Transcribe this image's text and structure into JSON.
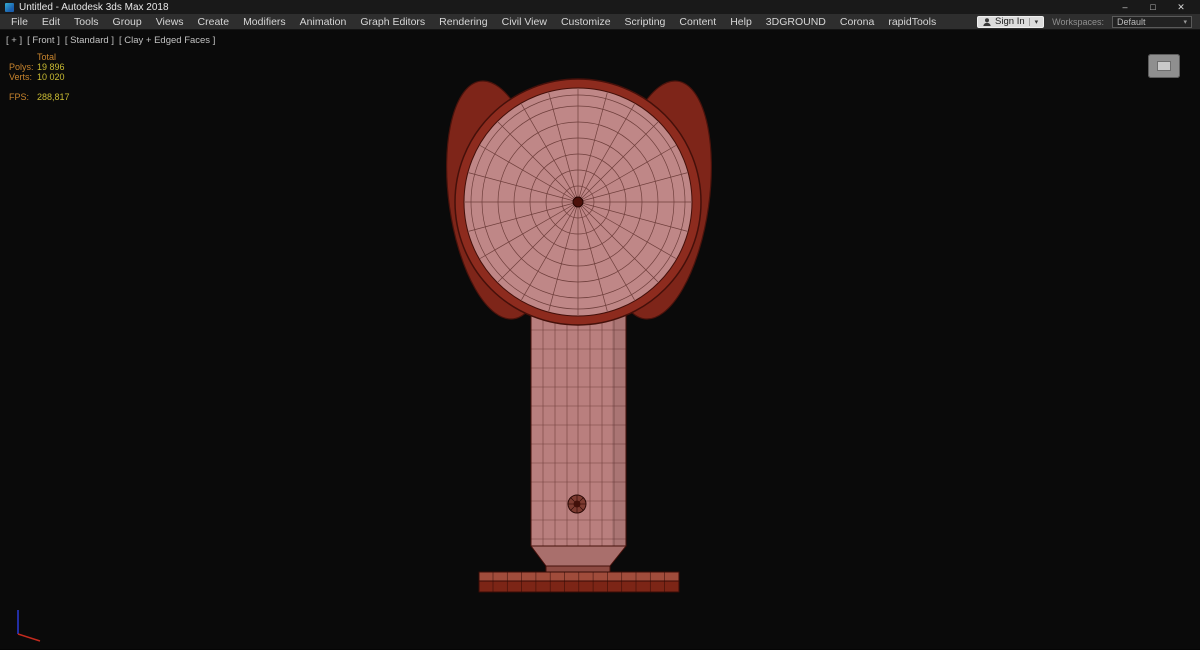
{
  "window": {
    "title": "Untitled - Autodesk 3ds Max 2018",
    "controls": {
      "minimize": "–",
      "maximize": "□",
      "close": "✕"
    }
  },
  "menubar": {
    "items": [
      "File",
      "Edit",
      "Tools",
      "Group",
      "Views",
      "Create",
      "Modifiers",
      "Animation",
      "Graph Editors",
      "Rendering",
      "Civil View",
      "Customize",
      "Scripting",
      "Content",
      "Help",
      "3DGROUND",
      "Corona",
      "rapidTools"
    ]
  },
  "account": {
    "sign_in": "Sign In"
  },
  "workspaces": {
    "label": "Workspaces:",
    "value": "Default"
  },
  "ui": {
    "caret": "▾"
  },
  "viewport": {
    "labels": [
      "[ + ]",
      "[ Front ]",
      "[ Standard ]",
      "[ Clay + Edged Faces ]"
    ],
    "stats": {
      "total_label": "Total",
      "polys_label": "Polys:",
      "polys_value": "19 896",
      "verts_label": "Verts:",
      "verts_value": "10 020",
      "fps_label": "FPS:",
      "fps_value": "288,817"
    }
  },
  "colors": {
    "viewport_bg": "#0a0a0a",
    "model_clay": "#bf8787",
    "model_rim": "#8d2b1e",
    "wire_edge": "#3a0f0a",
    "stats_label": "#c8842d",
    "stats_value": "#c9bb33"
  }
}
